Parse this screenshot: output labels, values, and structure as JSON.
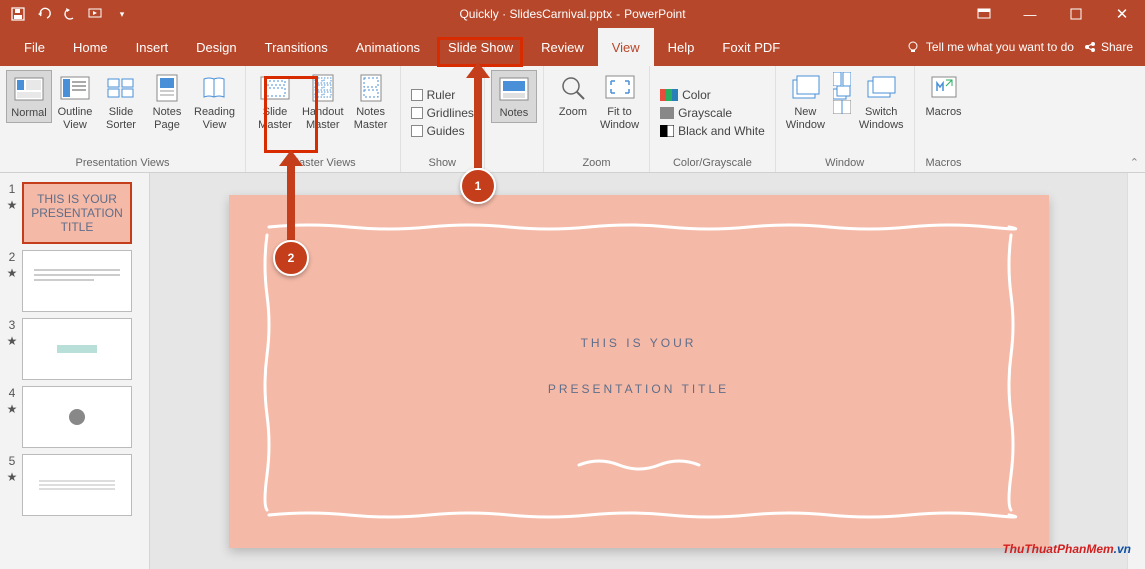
{
  "titlebar": {
    "filename": "Quickly · SlidesCarnival.pptx",
    "app": "PowerPoint"
  },
  "tabs": {
    "file": "File",
    "home": "Home",
    "insert": "Insert",
    "design": "Design",
    "transitions": "Transitions",
    "animations": "Animations",
    "slideshow": "Slide Show",
    "review": "Review",
    "view": "View",
    "help": "Help",
    "foxit": "Foxit PDF",
    "tellme": "Tell me what you want to do",
    "share": "Share"
  },
  "ribbon": {
    "presentation_views": {
      "label": "Presentation Views",
      "normal": "Normal",
      "outline": "Outline\nView",
      "sorter": "Slide\nSorter",
      "notespage": "Notes\nPage",
      "reading": "Reading\nView"
    },
    "master_views": {
      "label": "Master Views",
      "slide": "Slide\nMaster",
      "handout": "Handout\nMaster",
      "notes": "Notes\nMaster"
    },
    "show": {
      "label": "Show",
      "ruler": "Ruler",
      "gridlines": "Gridlines",
      "guides": "Guides"
    },
    "notes": {
      "label": "Notes",
      "btn": "Notes"
    },
    "zoom": {
      "label": "Zoom",
      "zoom": "Zoom",
      "fit": "Fit to\nWindow"
    },
    "color": {
      "label": "Color/Grayscale",
      "color": "Color",
      "gray": "Grayscale",
      "bw": "Black and White"
    },
    "window": {
      "label": "Window",
      "new": "New\nWindow",
      "switch": "Switch\nWindows"
    },
    "macros": {
      "label": "Macros",
      "btn": "Macros"
    }
  },
  "thumbs": [
    {
      "num": "1",
      "text": "THIS IS YOUR\nPRESENTATION TITLE"
    },
    {
      "num": "2",
      "text": ""
    },
    {
      "num": "3",
      "text": ""
    },
    {
      "num": "4",
      "text": ""
    },
    {
      "num": "5",
      "text": ""
    }
  ],
  "slide": {
    "title_l1": "THIS IS YOUR",
    "title_l2": "PRESENTATION TITLE"
  },
  "callouts": {
    "c1": "1",
    "c2": "2"
  },
  "watermark": {
    "part1": "ThuThuatPhanMem",
    "part2": ".vn"
  }
}
